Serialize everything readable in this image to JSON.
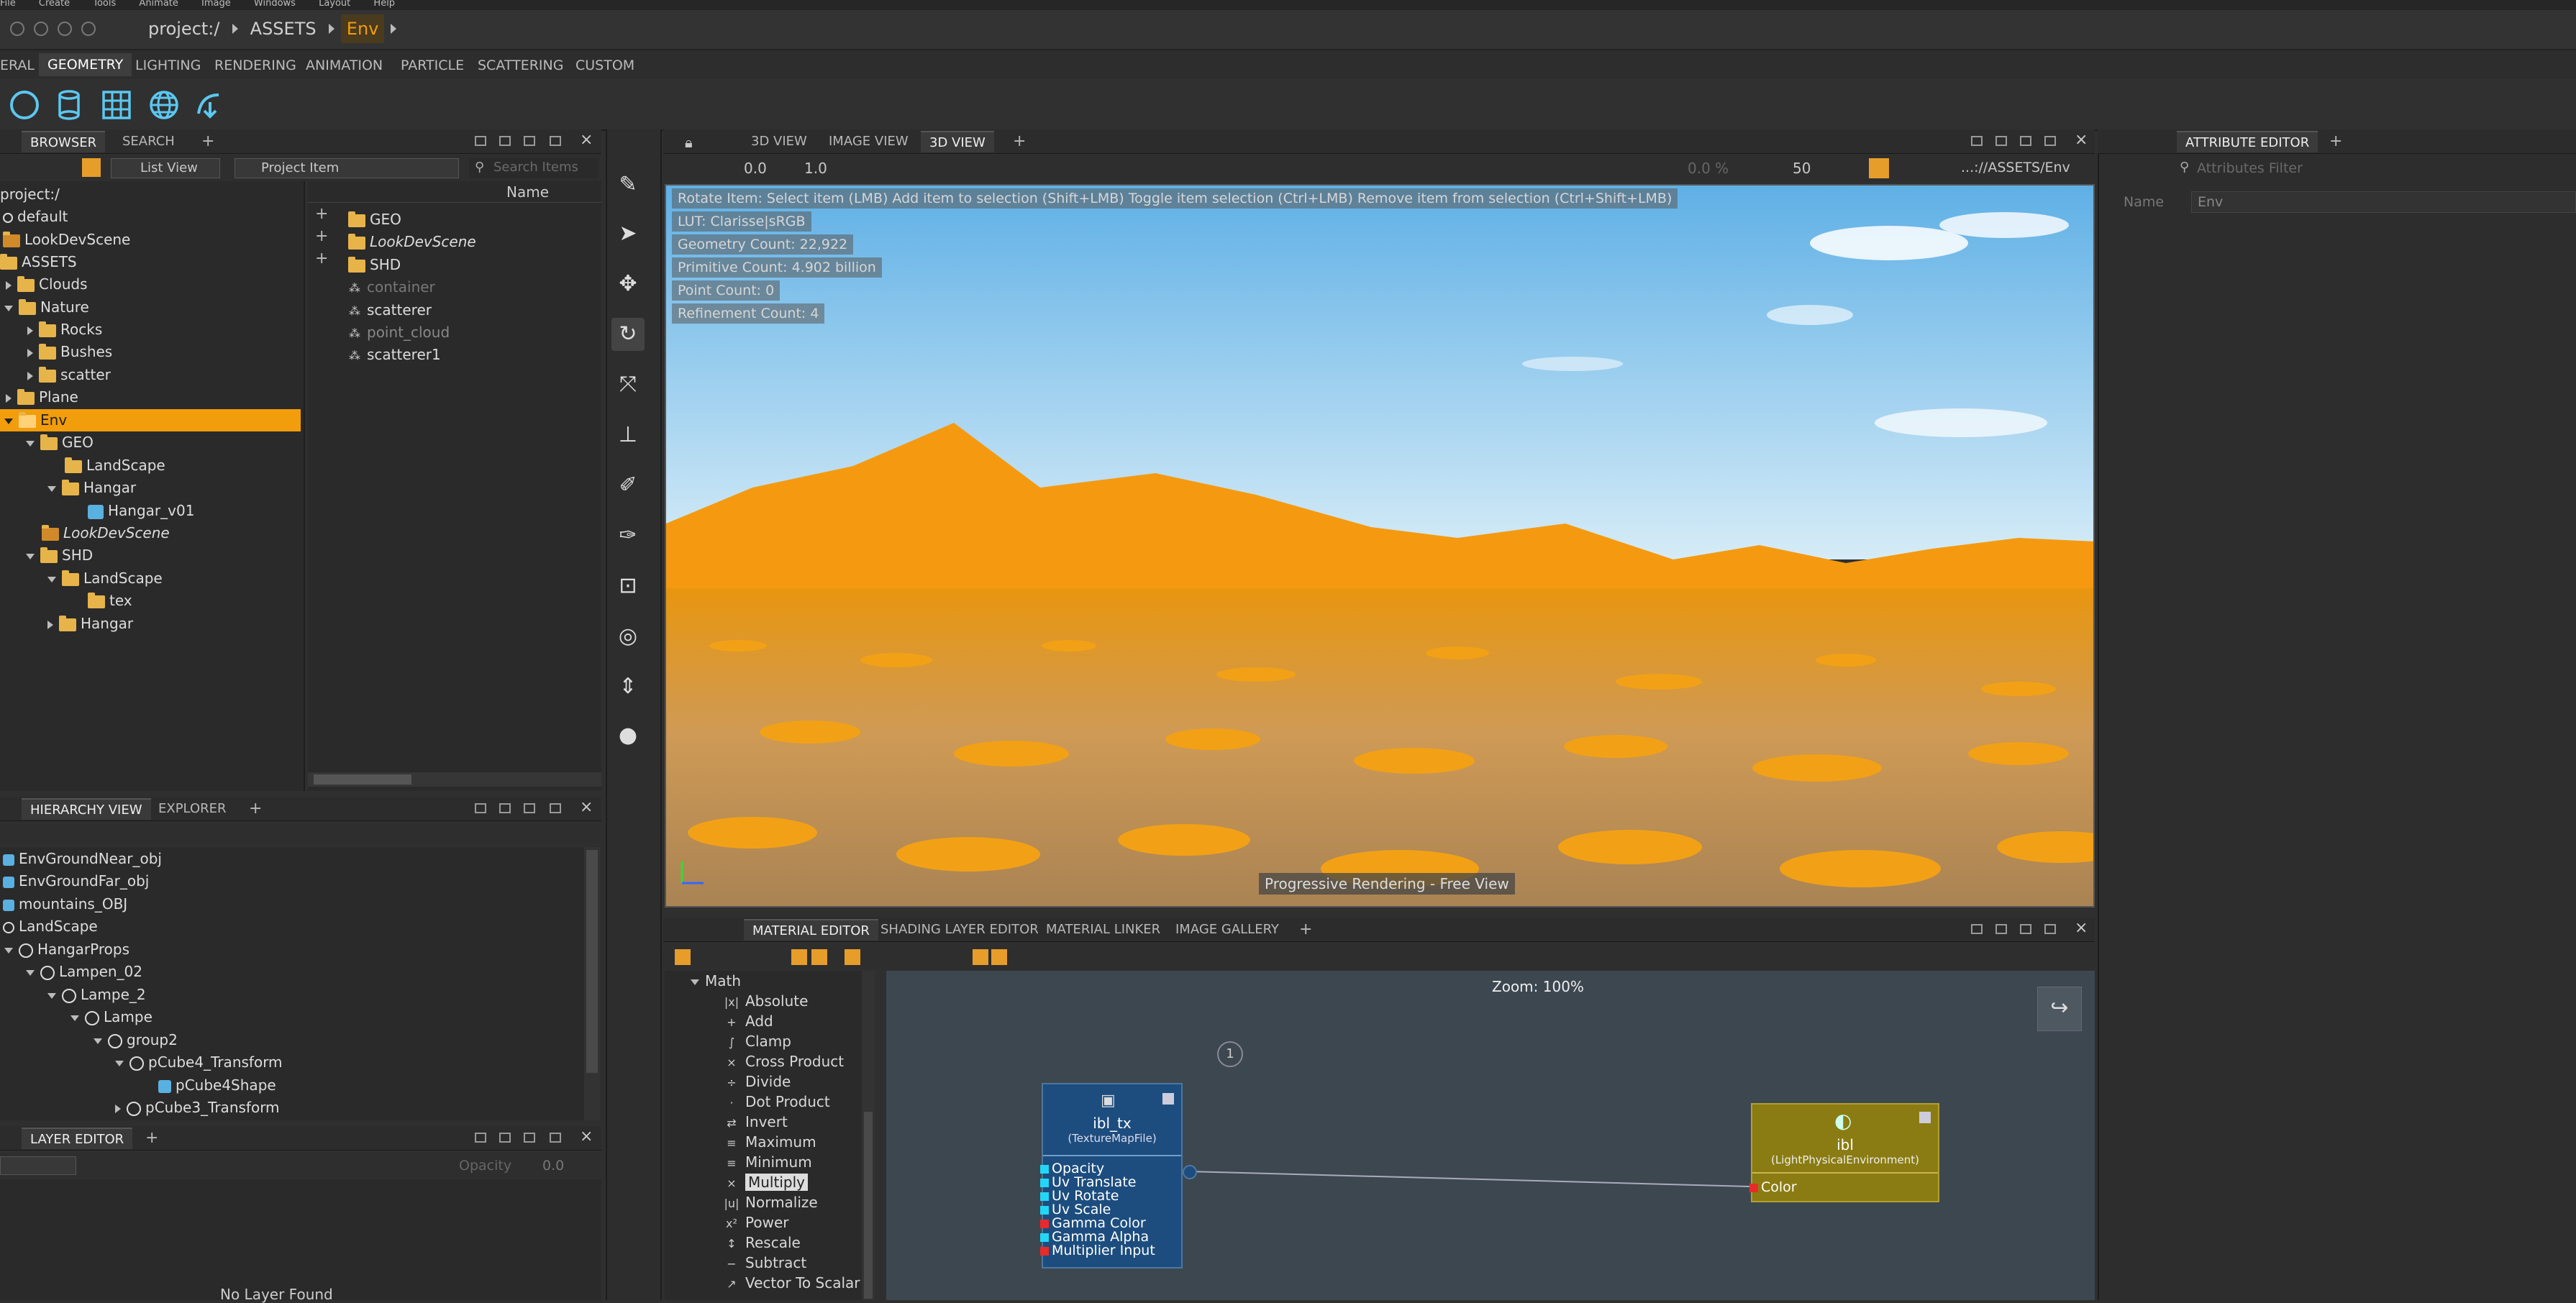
{
  "menubar": {
    "items": [
      "File",
      "Create",
      "Tools",
      "Animate",
      "Image",
      "Windows",
      "Layout",
      "Help"
    ]
  },
  "breadcrumb": {
    "items": [
      "project:/",
      "ASSETS",
      "Env"
    ]
  },
  "shelf": {
    "tabs": [
      "ERAL",
      "GEOMETRY",
      "LIGHTING",
      "RENDERING",
      "ANIMATION",
      "PARTICLE",
      "SCATTERING",
      "CUSTOM"
    ],
    "active": "GEOMETRY"
  },
  "browser": {
    "tabs": [
      "BROWSER",
      "SEARCH"
    ],
    "view_mode": "List View",
    "project_item": "Project Item",
    "search_placeholder": "Search Items",
    "name_header": "Name",
    "tree": [
      "project:/",
      "default",
      "LookDevScene",
      "ASSETS",
      "Clouds",
      "Nature",
      "Rocks",
      "Bushes",
      "scatter",
      "Plane",
      "Env",
      "GEO",
      "LandScape",
      "Hangar",
      "Hangar_v01",
      "LookDevScene",
      "SHD",
      "LandScape",
      "tex",
      "Hangar"
    ],
    "items": [
      "GEO",
      "LookDevScene",
      "SHD",
      "container",
      "scatterer",
      "point_cloud",
      "scatterer1"
    ]
  },
  "hierarchy": {
    "tabs": [
      "HIERARCHY VIEW",
      "EXPLORER"
    ],
    "rows": [
      "EnvGroundNear_obj",
      "EnvGroundFar_obj",
      "mountains_OBJ",
      "LandScape",
      "HangarProps",
      "Lampen_02",
      "Lampe_2",
      "Lampe",
      "group2",
      "pCube4_Transform",
      "pCube4Shape",
      "pCube3_Transform"
    ]
  },
  "layer_editor": {
    "title": "LAYER EDITOR",
    "opacity_label": "Opacity",
    "opacity_value": "0.0",
    "empty_text": "No Layer Found"
  },
  "viewport": {
    "tabs": [
      "3D VIEW",
      "IMAGE VIEW",
      "3D VIEW"
    ],
    "toolbar_value1": "0.0",
    "toolbar_value2": "1.0",
    "percent": "0.0 %",
    "samples": "50",
    "path": "...://ASSETS/Env",
    "info_lines": [
      "Rotate Item: Select item (LMB)  Add item to selection (Shift+LMB)  Toggle item selection (Ctrl+LMB)  Remove item from selection (Ctrl+Shift+LMB)",
      "LUT: Clarisse|sRGB",
      "Geometry Count: 22,922",
      "Primitive Count: 4.902 billion",
      "Point Count: 0",
      "Refinement Count: 4"
    ],
    "status": "Progressive Rendering - Free View",
    "sky_color": "#8cc7ea",
    "mountain_color": "#f59a10",
    "ground_color": "#b98f58"
  },
  "attribute_editor": {
    "title": "ATTRIBUTE EDITOR",
    "filter_placeholder": "Attributes Filter",
    "name_label": "Name",
    "name_value": "Env"
  },
  "material_editor": {
    "tabs": [
      "MATERIAL EDITOR",
      "SHADING LAYER EDITOR",
      "MATERIAL LINKER",
      "IMAGE GALLERY"
    ],
    "zoom": "Zoom: 100%",
    "category": "Math",
    "nodes_list": [
      "Absolute",
      "Add",
      "Clamp",
      "Cross Product",
      "Divide",
      "Dot Product",
      "Invert",
      "Maximum",
      "Minimum",
      "Multiply",
      "Normalize",
      "Power",
      "Rescale",
      "Subtract",
      "Vector To Scalar"
    ],
    "texture_node": {
      "name": "ibl_tx",
      "type": "(TextureMapFile)",
      "ports": [
        "Opacity",
        "Uv Translate",
        "Uv Rotate",
        "Uv Scale",
        "Gamma Color",
        "Gamma Alpha",
        "Multiplier Input"
      ]
    },
    "light_node": {
      "name": "ibl",
      "type": "(LightPhysicalEnvironment)",
      "ports": [
        "Color"
      ]
    },
    "badge": "1"
  }
}
